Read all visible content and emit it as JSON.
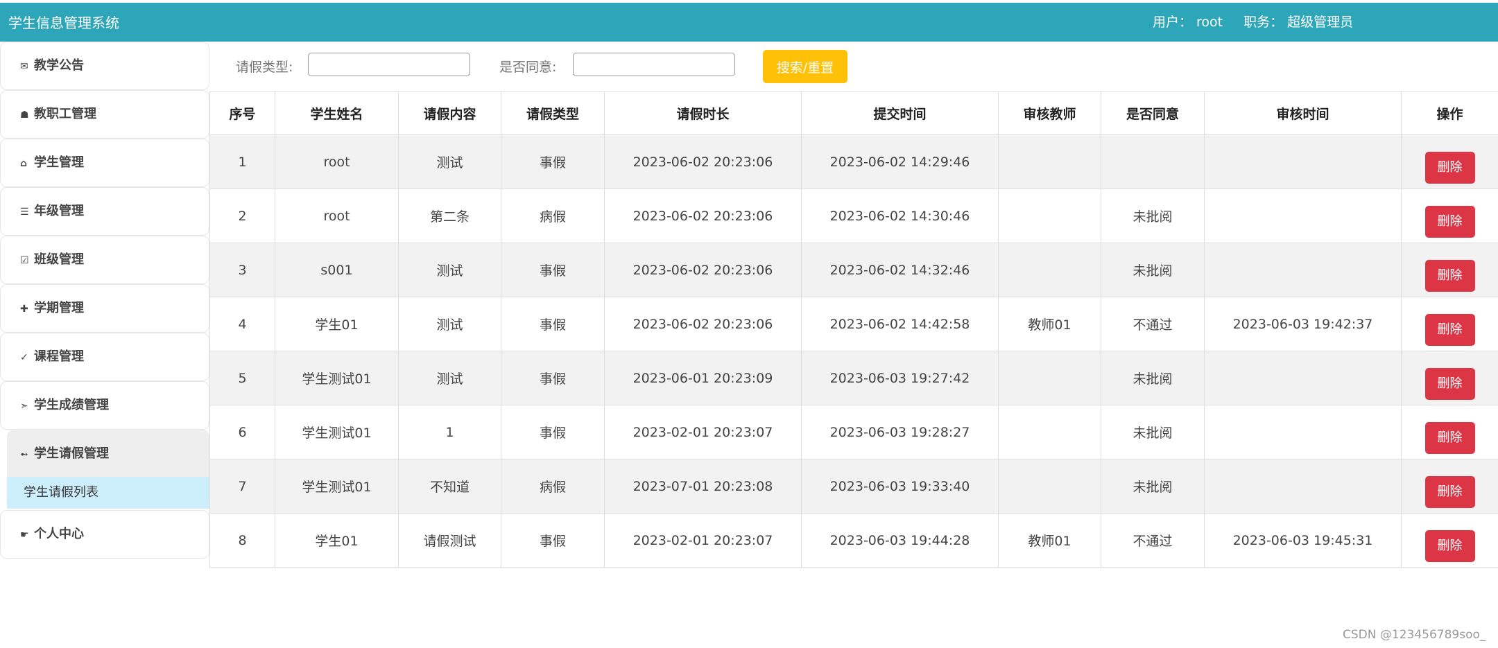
{
  "app": {
    "title": "学生信息管理系统",
    "user_label": "用户：",
    "user_value": "root",
    "role_label": "职务：",
    "role_value": "超级管理员"
  },
  "sidebar": {
    "items": [
      {
        "icon": "✉",
        "label": "教学公告"
      },
      {
        "icon": "☗",
        "label": "教职工管理"
      },
      {
        "icon": "⌂",
        "label": "学生管理"
      },
      {
        "icon": "☰",
        "label": "年级管理"
      },
      {
        "icon": "☑",
        "label": "班级管理"
      },
      {
        "icon": "✚",
        "label": "学期管理"
      },
      {
        "icon": "✓",
        "label": "课程管理"
      },
      {
        "icon": "➣",
        "label": "学生成绩管理"
      },
      {
        "icon": "➻",
        "label": "学生请假管理"
      },
      {
        "icon": "☛",
        "label": "个人中心"
      }
    ],
    "submenu_label": "学生请假列表"
  },
  "search": {
    "leave_type_label": "请假类型:",
    "leave_type_value": "",
    "agree_label": "是否同意:",
    "agree_value": "",
    "button_label": "搜索/重置"
  },
  "table": {
    "headers": [
      "序号",
      "学生姓名",
      "请假内容",
      "请假类型",
      "请假时长",
      "提交时间",
      "审核教师",
      "是否同意",
      "审核时间",
      "操作"
    ],
    "delete_label": "删除",
    "rows": [
      [
        "1",
        "root",
        "测试",
        "事假",
        "2023-06-02 20:23:06",
        "2023-06-02 14:29:46",
        "",
        "",
        ""
      ],
      [
        "2",
        "root",
        "第二条",
        "病假",
        "2023-06-02 20:23:06",
        "2023-06-02 14:30:46",
        "",
        "未批阅",
        ""
      ],
      [
        "3",
        "s001",
        "测试",
        "事假",
        "2023-06-02 20:23:06",
        "2023-06-02 14:32:46",
        "",
        "未批阅",
        ""
      ],
      [
        "4",
        "学生01",
        "测试",
        "事假",
        "2023-06-02 20:23:06",
        "2023-06-02 14:42:58",
        "教师01",
        "不通过",
        "2023-06-03 19:42:37"
      ],
      [
        "5",
        "学生测试01",
        "测试",
        "事假",
        "2023-06-01 20:23:09",
        "2023-06-03 19:27:42",
        "",
        "未批阅",
        ""
      ],
      [
        "6",
        "学生测试01",
        "1",
        "事假",
        "2023-02-01 20:23:07",
        "2023-06-03 19:28:27",
        "",
        "未批阅",
        ""
      ],
      [
        "7",
        "学生测试01",
        "不知道",
        "病假",
        "2023-07-01 20:23:08",
        "2023-06-03 19:33:40",
        "",
        "未批阅",
        ""
      ],
      [
        "8",
        "学生01",
        "请假测试",
        "事假",
        "2023-02-01 20:23:07",
        "2023-06-03 19:44:28",
        "教师01",
        "不通过",
        "2023-06-03 19:45:31"
      ]
    ]
  },
  "watermark": "CSDN @123456789soo_"
}
